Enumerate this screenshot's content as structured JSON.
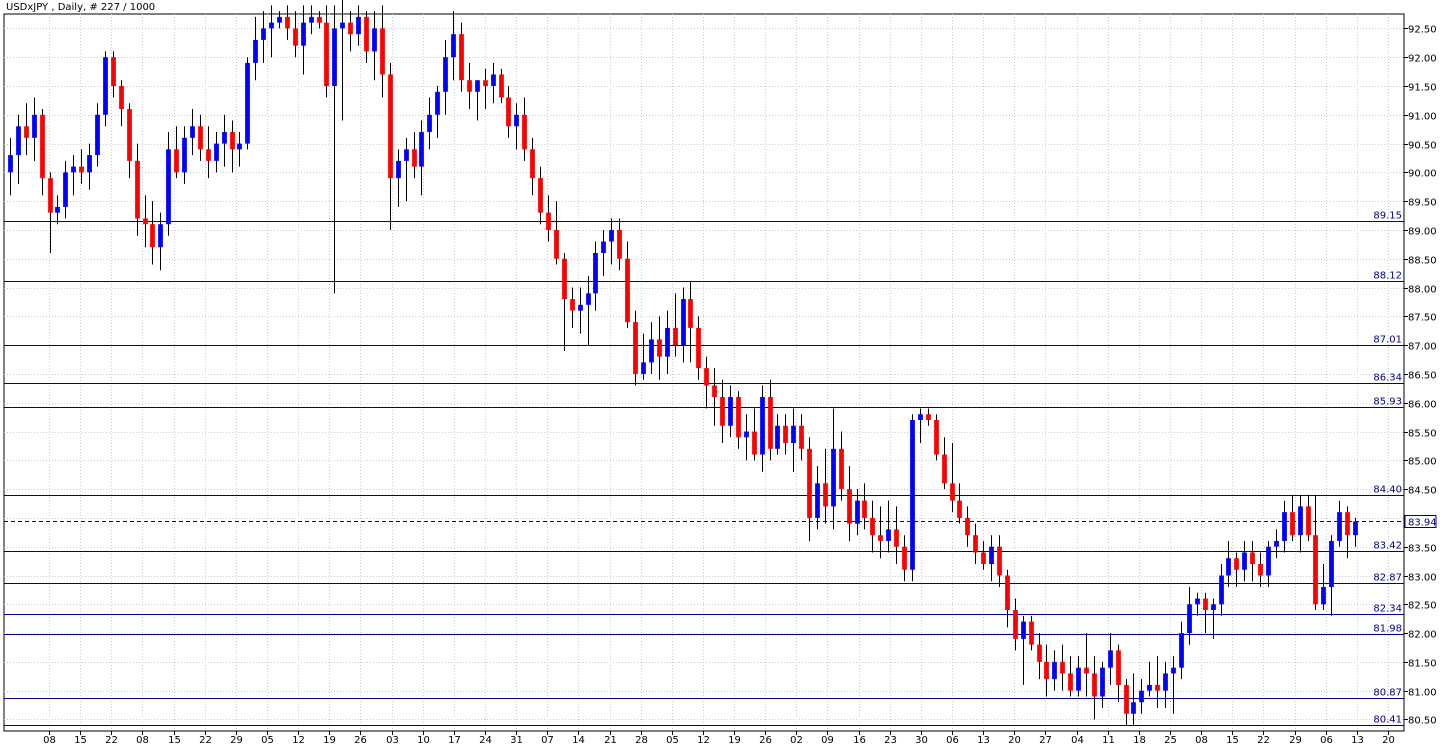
{
  "title": "USDxJPY , Daily, # 227 / 1000",
  "chart_data": {
    "type": "candlestick",
    "y_ticks": [
      "92.50",
      "92.00",
      "91.50",
      "91.00",
      "90.50",
      "90.00",
      "89.50",
      "89.00",
      "88.50",
      "88.00",
      "87.50",
      "87.00",
      "86.50",
      "86.00",
      "85.50",
      "85.00",
      "84.50",
      "84.00",
      "83.50",
      "83.00",
      "82.50",
      "82.00",
      "81.50",
      "81.00",
      "80.50"
    ],
    "x_ticks": [
      "08",
      "15",
      "22",
      "08",
      "15",
      "22",
      "29",
      "05",
      "12",
      "19",
      "26",
      "03",
      "10",
      "17",
      "24",
      "31",
      "07",
      "14",
      "21",
      "28",
      "05",
      "12",
      "19",
      "26",
      "02",
      "09",
      "16",
      "23",
      "30",
      "06",
      "13",
      "20",
      "27",
      "04",
      "11",
      "18",
      "25",
      "08",
      "15",
      "22",
      "29",
      "06",
      "13",
      "20"
    ],
    "ylim": [
      80.3,
      92.75
    ],
    "levels": [
      "89.15",
      "88.12",
      "87.01",
      "86.34",
      "85.93",
      "84.40",
      "83.42",
      "82.87",
      "82.34",
      "81.98",
      "80.87",
      "80.41"
    ],
    "current_price": "83.94",
    "colors": {
      "up": "#0000ff",
      "down": "#ff0000",
      "wick": "#000000",
      "grid": "#c9cbd6",
      "level": "#00008b",
      "current": "#00008b"
    },
    "candles": [
      [
        90.0,
        90.6,
        89.6,
        90.3
      ],
      [
        90.3,
        91.0,
        89.8,
        90.8
      ],
      [
        90.8,
        91.2,
        90.3,
        90.6
      ],
      [
        90.6,
        91.3,
        90.2,
        91.0
      ],
      [
        91.0,
        91.1,
        89.6,
        89.9
      ],
      [
        89.9,
        90.0,
        88.6,
        89.3
      ],
      [
        89.3,
        89.6,
        89.1,
        89.4
      ],
      [
        89.4,
        90.2,
        89.2,
        90.0
      ],
      [
        90.0,
        90.3,
        89.6,
        90.1
      ],
      [
        90.1,
        90.4,
        89.8,
        90.0
      ],
      [
        90.0,
        90.5,
        89.7,
        90.3
      ],
      [
        90.3,
        91.2,
        90.1,
        91.0
      ],
      [
        91.0,
        92.1,
        90.8,
        92.0
      ],
      [
        92.0,
        92.1,
        91.3,
        91.5
      ],
      [
        91.5,
        91.6,
        90.8,
        91.1
      ],
      [
        91.1,
        91.2,
        89.9,
        90.2
      ],
      [
        90.2,
        90.5,
        88.9,
        89.2
      ],
      [
        89.2,
        89.6,
        88.7,
        89.1
      ],
      [
        89.1,
        89.5,
        88.4,
        88.7
      ],
      [
        88.7,
        89.3,
        88.3,
        89.1
      ],
      [
        89.1,
        90.7,
        88.9,
        90.4
      ],
      [
        90.4,
        90.8,
        89.9,
        90.0
      ],
      [
        90.0,
        90.8,
        89.8,
        90.6
      ],
      [
        90.6,
        91.1,
        90.3,
        90.8
      ],
      [
        90.8,
        91.0,
        90.2,
        90.4
      ],
      [
        90.4,
        90.8,
        89.9,
        90.2
      ],
      [
        90.2,
        90.7,
        90.0,
        90.5
      ],
      [
        90.5,
        91.0,
        90.1,
        90.7
      ],
      [
        90.7,
        90.9,
        90.0,
        90.4
      ],
      [
        90.4,
        90.7,
        90.1,
        90.5
      ],
      [
        90.5,
        92.0,
        90.4,
        91.9
      ],
      [
        91.9,
        92.7,
        91.6,
        92.3
      ],
      [
        92.3,
        92.8,
        91.9,
        92.5
      ],
      [
        92.5,
        92.9,
        92.0,
        92.6
      ],
      [
        92.6,
        92.8,
        92.5,
        92.7
      ],
      [
        92.7,
        92.9,
        92.3,
        92.5
      ],
      [
        92.5,
        92.8,
        92.0,
        92.2
      ],
      [
        92.2,
        92.9,
        91.7,
        92.6
      ],
      [
        92.6,
        92.9,
        92.4,
        92.7
      ],
      [
        92.7,
        92.8,
        92.5,
        92.6
      ],
      [
        92.6,
        92.9,
        91.3,
        91.5
      ],
      [
        91.5,
        92.9,
        87.9,
        92.5
      ],
      [
        92.5,
        93.0,
        90.9,
        92.6
      ],
      [
        92.6,
        92.8,
        92.1,
        92.4
      ],
      [
        92.4,
        92.9,
        92.2,
        92.7
      ],
      [
        92.7,
        92.8,
        91.9,
        92.1
      ],
      [
        92.1,
        92.8,
        91.6,
        92.5
      ],
      [
        92.5,
        92.9,
        91.3,
        91.7
      ],
      [
        91.7,
        91.9,
        89.0,
        89.9
      ],
      [
        89.9,
        90.4,
        89.4,
        90.2
      ],
      [
        90.2,
        90.6,
        89.5,
        90.4
      ],
      [
        90.4,
        90.7,
        89.9,
        90.1
      ],
      [
        90.1,
        90.9,
        89.6,
        90.7
      ],
      [
        90.7,
        91.3,
        90.4,
        91.0
      ],
      [
        91.0,
        91.5,
        90.6,
        91.4
      ],
      [
        91.4,
        92.3,
        91.0,
        92.0
      ],
      [
        92.0,
        92.8,
        91.6,
        92.4
      ],
      [
        92.4,
        92.6,
        91.4,
        91.6
      ],
      [
        91.6,
        91.9,
        91.1,
        91.4
      ],
      [
        91.4,
        91.6,
        90.9,
        91.6
      ],
      [
        91.6,
        91.8,
        91.1,
        91.5
      ],
      [
        91.5,
        91.9,
        91.2,
        91.7
      ],
      [
        91.7,
        91.8,
        91.2,
        91.3
      ],
      [
        91.3,
        91.5,
        90.6,
        90.8
      ],
      [
        90.8,
        91.2,
        90.4,
        91.0
      ],
      [
        91.0,
        91.3,
        90.2,
        90.4
      ],
      [
        90.4,
        90.6,
        89.6,
        89.9
      ],
      [
        89.9,
        90.1,
        89.1,
        89.3
      ],
      [
        89.3,
        89.6,
        88.8,
        89.0
      ],
      [
        89.0,
        89.5,
        88.4,
        88.5
      ],
      [
        88.5,
        88.6,
        86.9,
        87.8
      ],
      [
        87.8,
        88.0,
        87.3,
        87.6
      ],
      [
        87.6,
        88.0,
        87.2,
        87.7
      ],
      [
        87.7,
        88.2,
        87.0,
        87.9
      ],
      [
        87.9,
        88.8,
        87.6,
        88.6
      ],
      [
        88.6,
        89.0,
        88.2,
        88.8
      ],
      [
        88.8,
        89.2,
        88.4,
        89.0
      ],
      [
        89.0,
        89.2,
        88.3,
        88.5
      ],
      [
        88.5,
        88.8,
        87.3,
        87.4
      ],
      [
        87.4,
        87.6,
        86.3,
        86.5
      ],
      [
        86.5,
        87.2,
        86.4,
        86.7
      ],
      [
        86.7,
        87.4,
        86.5,
        87.1
      ],
      [
        87.1,
        87.5,
        86.4,
        86.8
      ],
      [
        86.8,
        87.6,
        86.5,
        87.3
      ],
      [
        87.3,
        87.9,
        86.8,
        87.0
      ],
      [
        87.0,
        88.0,
        86.7,
        87.8
      ],
      [
        87.8,
        88.1,
        86.7,
        87.3
      ],
      [
        87.3,
        87.5,
        86.4,
        86.6
      ],
      [
        86.6,
        86.8,
        85.9,
        86.3
      ],
      [
        86.3,
        86.6,
        85.6,
        86.1
      ],
      [
        86.1,
        86.4,
        85.3,
        85.6
      ],
      [
        85.6,
        86.3,
        85.4,
        86.1
      ],
      [
        86.1,
        86.2,
        85.2,
        85.4
      ],
      [
        85.4,
        85.8,
        85.0,
        85.5
      ],
      [
        85.5,
        85.9,
        85.0,
        85.1
      ],
      [
        85.1,
        86.3,
        84.8,
        86.1
      ],
      [
        86.1,
        86.4,
        85.0,
        85.2
      ],
      [
        85.2,
        85.8,
        85.1,
        85.6
      ],
      [
        85.6,
        85.8,
        85.1,
        85.3
      ],
      [
        85.3,
        85.9,
        84.8,
        85.6
      ],
      [
        85.6,
        85.8,
        85.0,
        85.2
      ],
      [
        85.2,
        85.4,
        83.6,
        84.0
      ],
      [
        84.0,
        84.9,
        83.8,
        84.6
      ],
      [
        84.6,
        85.2,
        83.9,
        84.2
      ],
      [
        84.2,
        85.9,
        83.8,
        85.2
      ],
      [
        85.2,
        85.5,
        84.3,
        84.5
      ],
      [
        84.5,
        84.9,
        83.6,
        83.9
      ],
      [
        83.9,
        84.5,
        83.7,
        84.3
      ],
      [
        84.3,
        84.6,
        83.8,
        84.0
      ],
      [
        84.0,
        84.3,
        83.4,
        83.7
      ],
      [
        83.7,
        84.2,
        83.3,
        83.6
      ],
      [
        83.6,
        84.3,
        83.4,
        83.8
      ],
      [
        83.8,
        84.2,
        83.2,
        83.5
      ],
      [
        83.5,
        83.7,
        82.9,
        83.1
      ],
      [
        83.1,
        85.8,
        82.9,
        85.7
      ],
      [
        85.7,
        85.9,
        85.3,
        85.8
      ],
      [
        85.8,
        85.9,
        85.6,
        85.7
      ],
      [
        85.7,
        85.8,
        85.0,
        85.1
      ],
      [
        85.1,
        85.4,
        84.5,
        84.6
      ],
      [
        84.6,
        85.3,
        84.1,
        84.3
      ],
      [
        84.3,
        84.6,
        83.9,
        84.0
      ],
      [
        84.0,
        84.2,
        83.5,
        83.7
      ],
      [
        83.7,
        83.9,
        83.2,
        83.4
      ],
      [
        83.4,
        83.6,
        83.1,
        83.2
      ],
      [
        83.2,
        83.7,
        82.9,
        83.5
      ],
      [
        83.5,
        83.7,
        82.8,
        83.0
      ],
      [
        83.0,
        83.1,
        82.1,
        82.4
      ],
      [
        82.4,
        82.6,
        81.7,
        81.9
      ],
      [
        81.9,
        82.3,
        81.1,
        82.2
      ],
      [
        82.2,
        82.3,
        81.7,
        81.8
      ],
      [
        81.8,
        82.0,
        81.2,
        81.5
      ],
      [
        81.5,
        81.8,
        80.9,
        81.2
      ],
      [
        81.2,
        81.7,
        81.0,
        81.5
      ],
      [
        81.5,
        81.8,
        81.0,
        81.3
      ],
      [
        81.3,
        81.6,
        80.9,
        81.0
      ],
      [
        81.0,
        81.6,
        80.9,
        81.4
      ],
      [
        81.4,
        82.0,
        80.9,
        81.3
      ],
      [
        81.3,
        81.6,
        80.5,
        80.9
      ],
      [
        80.9,
        81.5,
        80.7,
        81.4
      ],
      [
        81.4,
        82.0,
        81.1,
        81.7
      ],
      [
        81.7,
        81.8,
        80.8,
        81.1
      ],
      [
        81.1,
        81.2,
        80.4,
        80.6
      ],
      [
        80.6,
        81.3,
        80.4,
        80.8
      ],
      [
        80.8,
        81.2,
        80.6,
        81.0
      ],
      [
        81.0,
        81.5,
        80.9,
        81.1
      ],
      [
        81.1,
        81.6,
        80.7,
        81.0
      ],
      [
        81.0,
        81.5,
        80.7,
        81.3
      ],
      [
        81.3,
        81.6,
        80.6,
        81.4
      ],
      [
        81.4,
        82.2,
        81.2,
        82.0
      ],
      [
        82.0,
        82.8,
        81.8,
        82.5
      ],
      [
        82.5,
        82.7,
        82.3,
        82.6
      ],
      [
        82.6,
        82.7,
        82.0,
        82.4
      ],
      [
        82.4,
        82.6,
        81.9,
        82.5
      ],
      [
        82.5,
        83.2,
        82.3,
        83.0
      ],
      [
        83.0,
        83.6,
        82.8,
        83.3
      ],
      [
        83.3,
        83.4,
        82.8,
        83.1
      ],
      [
        83.1,
        83.6,
        82.9,
        83.4
      ],
      [
        83.4,
        83.6,
        82.9,
        83.2
      ],
      [
        83.2,
        83.4,
        82.8,
        83.0
      ],
      [
        83.0,
        83.6,
        82.8,
        83.5
      ],
      [
        83.5,
        83.8,
        83.3,
        83.6
      ],
      [
        83.6,
        84.3,
        83.4,
        84.1
      ],
      [
        84.1,
        84.4,
        83.6,
        83.7
      ],
      [
        83.7,
        84.4,
        83.4,
        84.2
      ],
      [
        84.2,
        84.4,
        83.6,
        83.7
      ],
      [
        83.7,
        84.4,
        82.4,
        82.5
      ],
      [
        82.5,
        83.2,
        82.4,
        82.8
      ],
      [
        82.8,
        83.7,
        82.3,
        83.6
      ],
      [
        83.6,
        84.3,
        83.5,
        84.1
      ],
      [
        84.1,
        84.2,
        83.3,
        83.7
      ],
      [
        83.7,
        84.0,
        83.5,
        83.94
      ]
    ]
  }
}
